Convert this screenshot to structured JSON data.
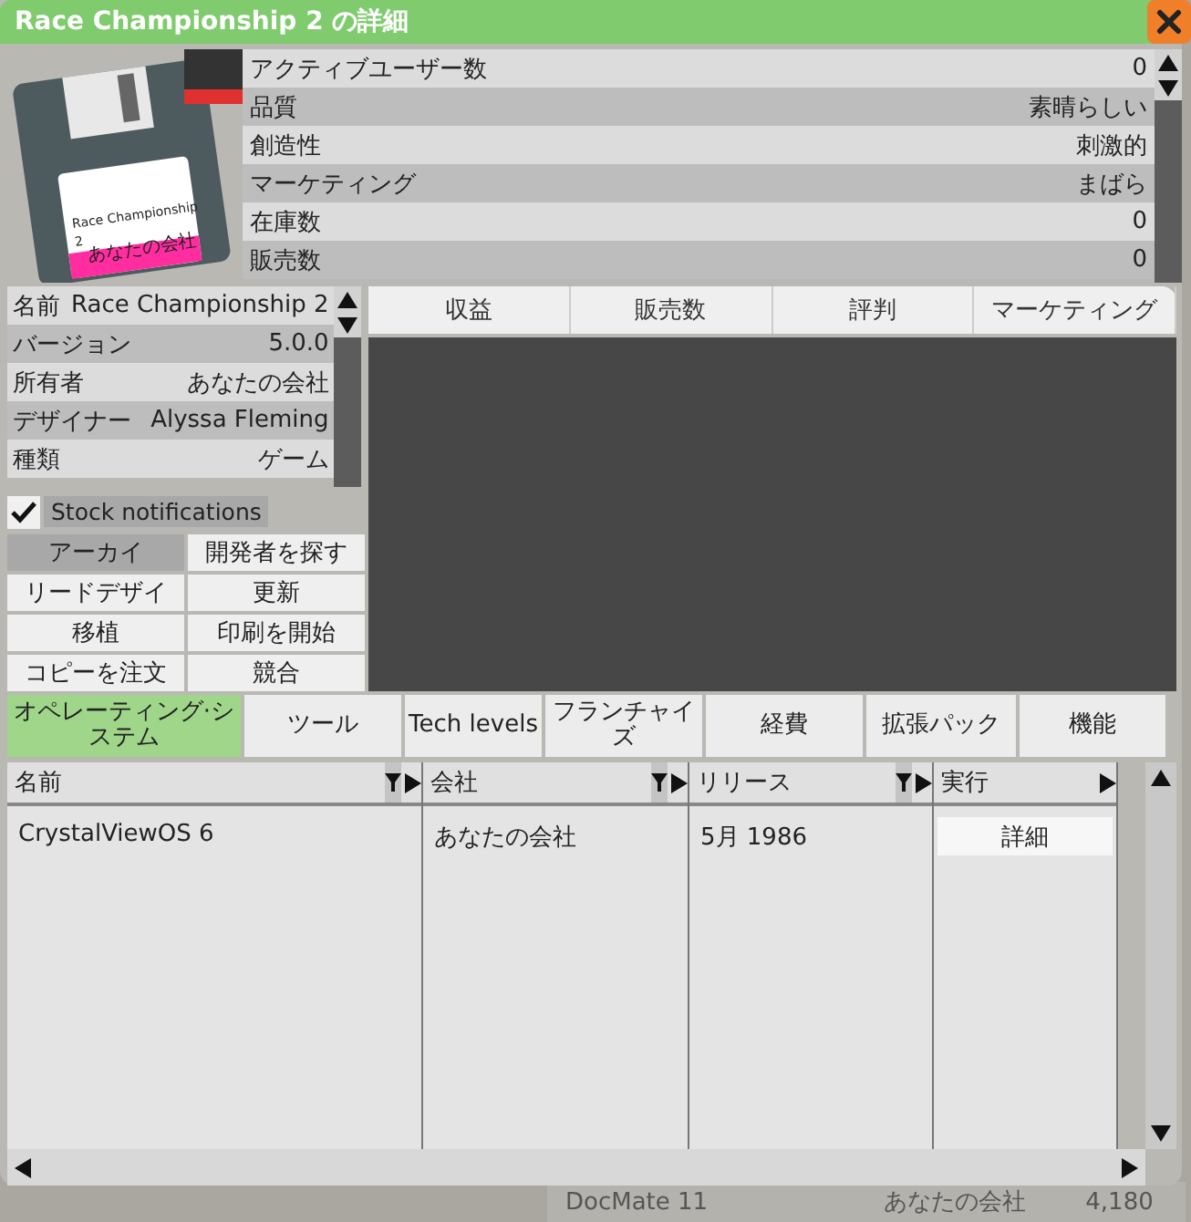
{
  "window": {
    "title": "Race Championship 2 の詳細"
  },
  "disk": {
    "label_title": "Race Championship 2",
    "label_company": "あなたの会社"
  },
  "stats": [
    {
      "label": "アクティブユーザー数",
      "value": "0"
    },
    {
      "label": "品質",
      "value": "素晴らしい"
    },
    {
      "label": "創造性",
      "value": "刺激的"
    },
    {
      "label": "マーケティング",
      "value": "まばら"
    },
    {
      "label": "在庫数",
      "value": "0"
    },
    {
      "label": "販売数",
      "value": "0"
    }
  ],
  "info": [
    {
      "label": "名前",
      "value": "Race Championship 2"
    },
    {
      "label": "バージョン",
      "value": "5.0.0"
    },
    {
      "label": "所有者",
      "value": "あなたの会社"
    },
    {
      "label": "デザイナー",
      "value": "Alyssa Fleming"
    },
    {
      "label": "種類",
      "value": "ゲーム"
    }
  ],
  "stock_notifications": {
    "label": "Stock notifications",
    "checked": true
  },
  "actions": [
    {
      "label": "アーカイ",
      "disabled": true
    },
    {
      "label": "開発者を探す",
      "disabled": false
    },
    {
      "label": "リードデザイ",
      "disabled": false
    },
    {
      "label": "更新",
      "disabled": false
    },
    {
      "label": "移植",
      "disabled": false
    },
    {
      "label": "印刷を開始",
      "disabled": false
    },
    {
      "label": "コピーを注文",
      "disabled": false
    },
    {
      "label": "競合",
      "disabled": false
    }
  ],
  "chart_tabs": [
    "収益",
    "販売数",
    "評判",
    "マーケティング"
  ],
  "tabs": [
    {
      "label": "オペレーティング·システム",
      "selected": true
    },
    {
      "label": "ツール",
      "selected": false
    },
    {
      "label": "Tech levels",
      "selected": false
    },
    {
      "label": "フランチャイズ",
      "selected": false
    },
    {
      "label": "経費",
      "selected": false
    },
    {
      "label": "拡張パック",
      "selected": false
    },
    {
      "label": "機能",
      "selected": false
    }
  ],
  "table": {
    "columns": [
      {
        "label": "名前",
        "filterable": true
      },
      {
        "label": "会社",
        "filterable": true
      },
      {
        "label": "リリース",
        "filterable": true
      },
      {
        "label": "実行",
        "filterable": false
      }
    ],
    "rows": [
      {
        "cells": [
          "CrystalViewOS 6",
          "あなたの会社",
          "5月 1986"
        ],
        "action": "詳細"
      }
    ]
  },
  "background_row": [
    "DocMate 11",
    "あなたの会社",
    "4,180"
  ]
}
